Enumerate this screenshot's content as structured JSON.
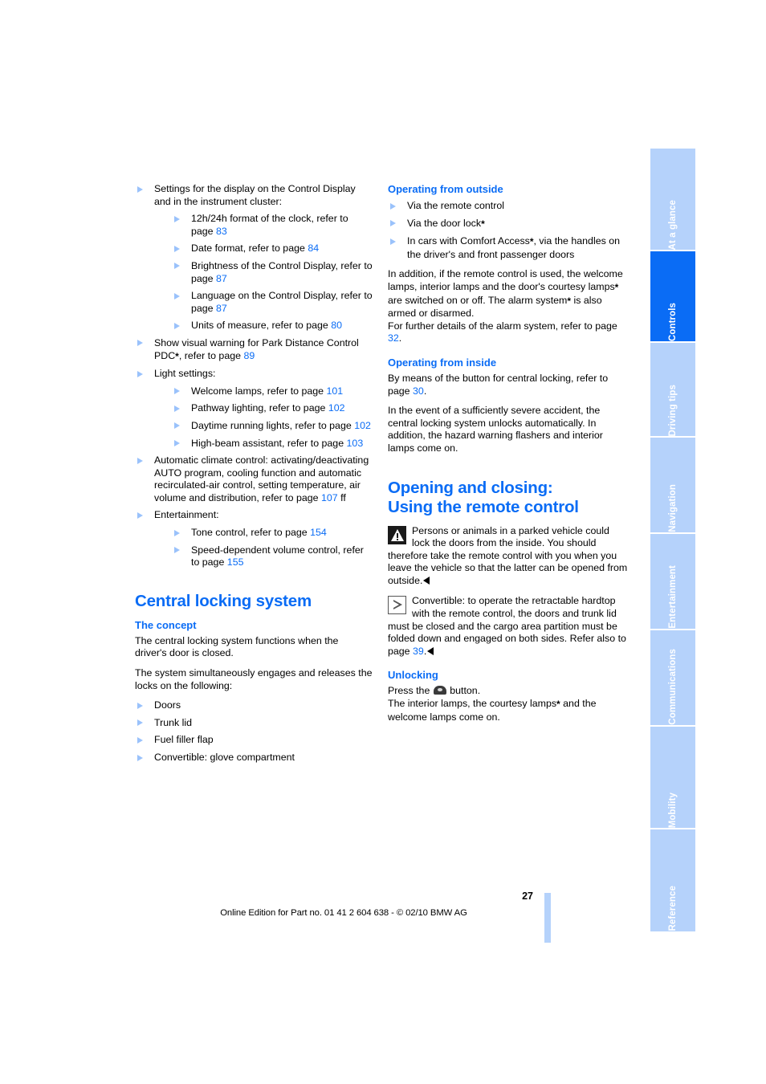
{
  "document": {
    "page_number": "27",
    "footer": "Online Edition for Part no. 01 41 2 604 638 - © 02/10 BMW AG"
  },
  "colors": {
    "accent_blue": "#0a6cf5",
    "tab_inactive": "#b5d2fb",
    "bullet_blue": "#9ac2fb"
  },
  "sidebar": {
    "tabs": [
      {
        "label": "At a glance",
        "active": false
      },
      {
        "label": "Controls",
        "active": true
      },
      {
        "label": "Driving tips",
        "active": false
      },
      {
        "label": "Navigation",
        "active": false
      },
      {
        "label": "Entertainment",
        "active": false
      },
      {
        "label": "Communications",
        "active": false
      },
      {
        "label": "Mobility",
        "active": false
      },
      {
        "label": "Reference",
        "active": false
      }
    ]
  },
  "left_column": {
    "settings_item": {
      "text": "Settings for the display on the Control Display and in the instrument cluster:",
      "sub_items": [
        {
          "text_before": "12h/24h format of the clock, refer to page ",
          "page": "83",
          "text_after": ""
        },
        {
          "text_before": "Date format, refer to page ",
          "page": "84",
          "text_after": ""
        },
        {
          "text_before": "Brightness of the Control Display, refer to page ",
          "page": "87",
          "text_after": ""
        },
        {
          "text_before": "Language on the Control Display, refer to page ",
          "page": "87",
          "text_after": ""
        },
        {
          "text_before": "Units of measure, refer to page ",
          "page": "80",
          "text_after": ""
        }
      ]
    },
    "pdc_item": {
      "text_before": "Show visual warning for Park Distance Control PDC",
      "asterisk": "*",
      "text_mid": ", refer to page ",
      "page": "89"
    },
    "light_settings": {
      "text": "Light settings:",
      "sub_items": [
        {
          "text_before": "Welcome lamps, refer to page ",
          "page": "101"
        },
        {
          "text_before": "Pathway lighting, refer to page ",
          "page": "102"
        },
        {
          "text_before": "Daytime running lights, refer to page ",
          "page": "102"
        },
        {
          "text_before": "High-beam assistant, refer to page ",
          "page": "103"
        }
      ]
    },
    "climate_item": {
      "text_before": "Automatic climate control: activating/deactivating AUTO program, cooling function and automatic recirculated-air control, setting temperature, air volume and distribution, refer to page ",
      "page": "107",
      "text_after": " ff"
    },
    "entertainment": {
      "text": "Entertainment:",
      "sub_items": [
        {
          "text_before": "Tone control, refer to page ",
          "page": "154"
        },
        {
          "text_before": "Speed-dependent volume control, refer to page ",
          "page": "155"
        }
      ]
    },
    "central_locking": {
      "heading": "Central locking system",
      "concept_heading": "The concept",
      "paragraph_1": "The central locking system functions when the driver's door is closed.",
      "paragraph_2": "The system simultaneously engages and releases the locks on the following:",
      "items": [
        "Doors",
        "Trunk lid",
        "Fuel filler flap",
        "Convertible: glove compartment"
      ]
    }
  },
  "right_column": {
    "operating_outside": {
      "heading": "Operating from outside",
      "items": [
        {
          "text": "Via the remote control",
          "asterisk": ""
        },
        {
          "text": "Via the door lock",
          "asterisk": "*"
        },
        {
          "text_before": "In cars with Comfort Access",
          "asterisk": "*",
          "text_after": ", via the handles on the driver's and front passenger doors"
        }
      ],
      "paragraph_before": "In addition, if the remote control is used, the welcome lamps, interior lamps and the door's courtesy lamps",
      "paragraph_ast_1": "*",
      "paragraph_mid": " are switched on or off. The alarm system",
      "paragraph_ast_2": "*",
      "paragraph_after": " is also armed or disarmed.",
      "paragraph_line2_before": "For further details of the alarm system, refer to page ",
      "paragraph_page": "32",
      "paragraph_line2_after": "."
    },
    "operating_inside": {
      "heading": "Operating from inside",
      "paragraph_1_before": "By means of the button for central locking, refer to page ",
      "paragraph_1_page": "30",
      "paragraph_1_after": ".",
      "paragraph_2": "In the event of a sufficiently severe accident, the central locking system unlocks automatically. In addition, the hazard warning flashers and interior lamps come on."
    },
    "opening_closing": {
      "heading_line1": "Opening and closing:",
      "heading_line2": "Using the remote control",
      "warning": {
        "icon": "warning-triangle-icon",
        "text": "Persons or animals in a parked vehicle could lock the doors from the inside. You should therefore take the remote control with you when you leave the vehicle so that the latter can be opened from outside."
      },
      "note": {
        "icon": "note-triangle-icon",
        "text_before": "Convertible: to operate the retractable hardtop with the remote control, the doors and trunk lid must be closed and the cargo area partition must be folded down and engaged on both sides. Refer also to page ",
        "page": "39",
        "text_after": "."
      },
      "unlocking": {
        "heading": "Unlocking",
        "line1_before": "Press the ",
        "icon": "unlock-key-button-icon",
        "line1_after": " button.",
        "line2_before": "The interior lamps, the courtesy lamps",
        "asterisk": "*",
        "line2_after": " and the welcome lamps come on."
      }
    }
  }
}
